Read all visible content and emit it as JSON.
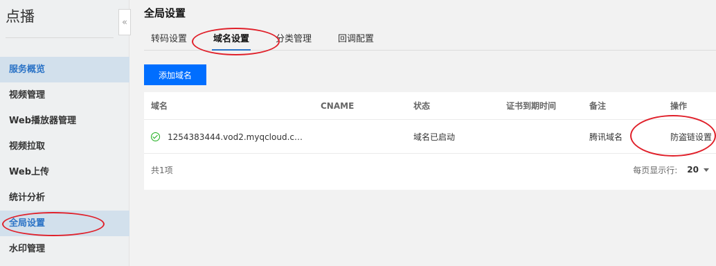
{
  "sidebar": {
    "app_title": "点播",
    "collapse_glyph": "«",
    "items": [
      {
        "label": "服务概览",
        "active": true
      },
      {
        "label": "视频管理"
      },
      {
        "label": "Web播放器管理"
      },
      {
        "label": "视频拉取"
      },
      {
        "label": "Web上传"
      },
      {
        "label": "统计分析"
      },
      {
        "label": "全局设置",
        "active": true
      },
      {
        "label": "水印管理"
      }
    ]
  },
  "main": {
    "title": "全局设置",
    "tabs": [
      {
        "label": "转码设置"
      },
      {
        "label": "域名设置",
        "active": true
      },
      {
        "label": "分类管理"
      },
      {
        "label": "回调配置"
      }
    ],
    "add_button": "添加域名",
    "table": {
      "headers": [
        "域名",
        "CNAME",
        "状态",
        "证书到期时间",
        "备注",
        "操作"
      ],
      "rows": [
        {
          "domain": "1254383444.vod2.myqcloud.c…",
          "cname": "",
          "status": "域名已启动",
          "cert_expiry": "",
          "remark": "腾讯域名",
          "action": "防盗链设置"
        }
      ],
      "total": "共1项",
      "page_size_label": "每页显示行:",
      "page_size": "20"
    }
  },
  "colors": {
    "accent": "#2b73c6",
    "primary_button": "#006eff",
    "annotation": "#e0202a",
    "status_ok": "#1aad19"
  }
}
